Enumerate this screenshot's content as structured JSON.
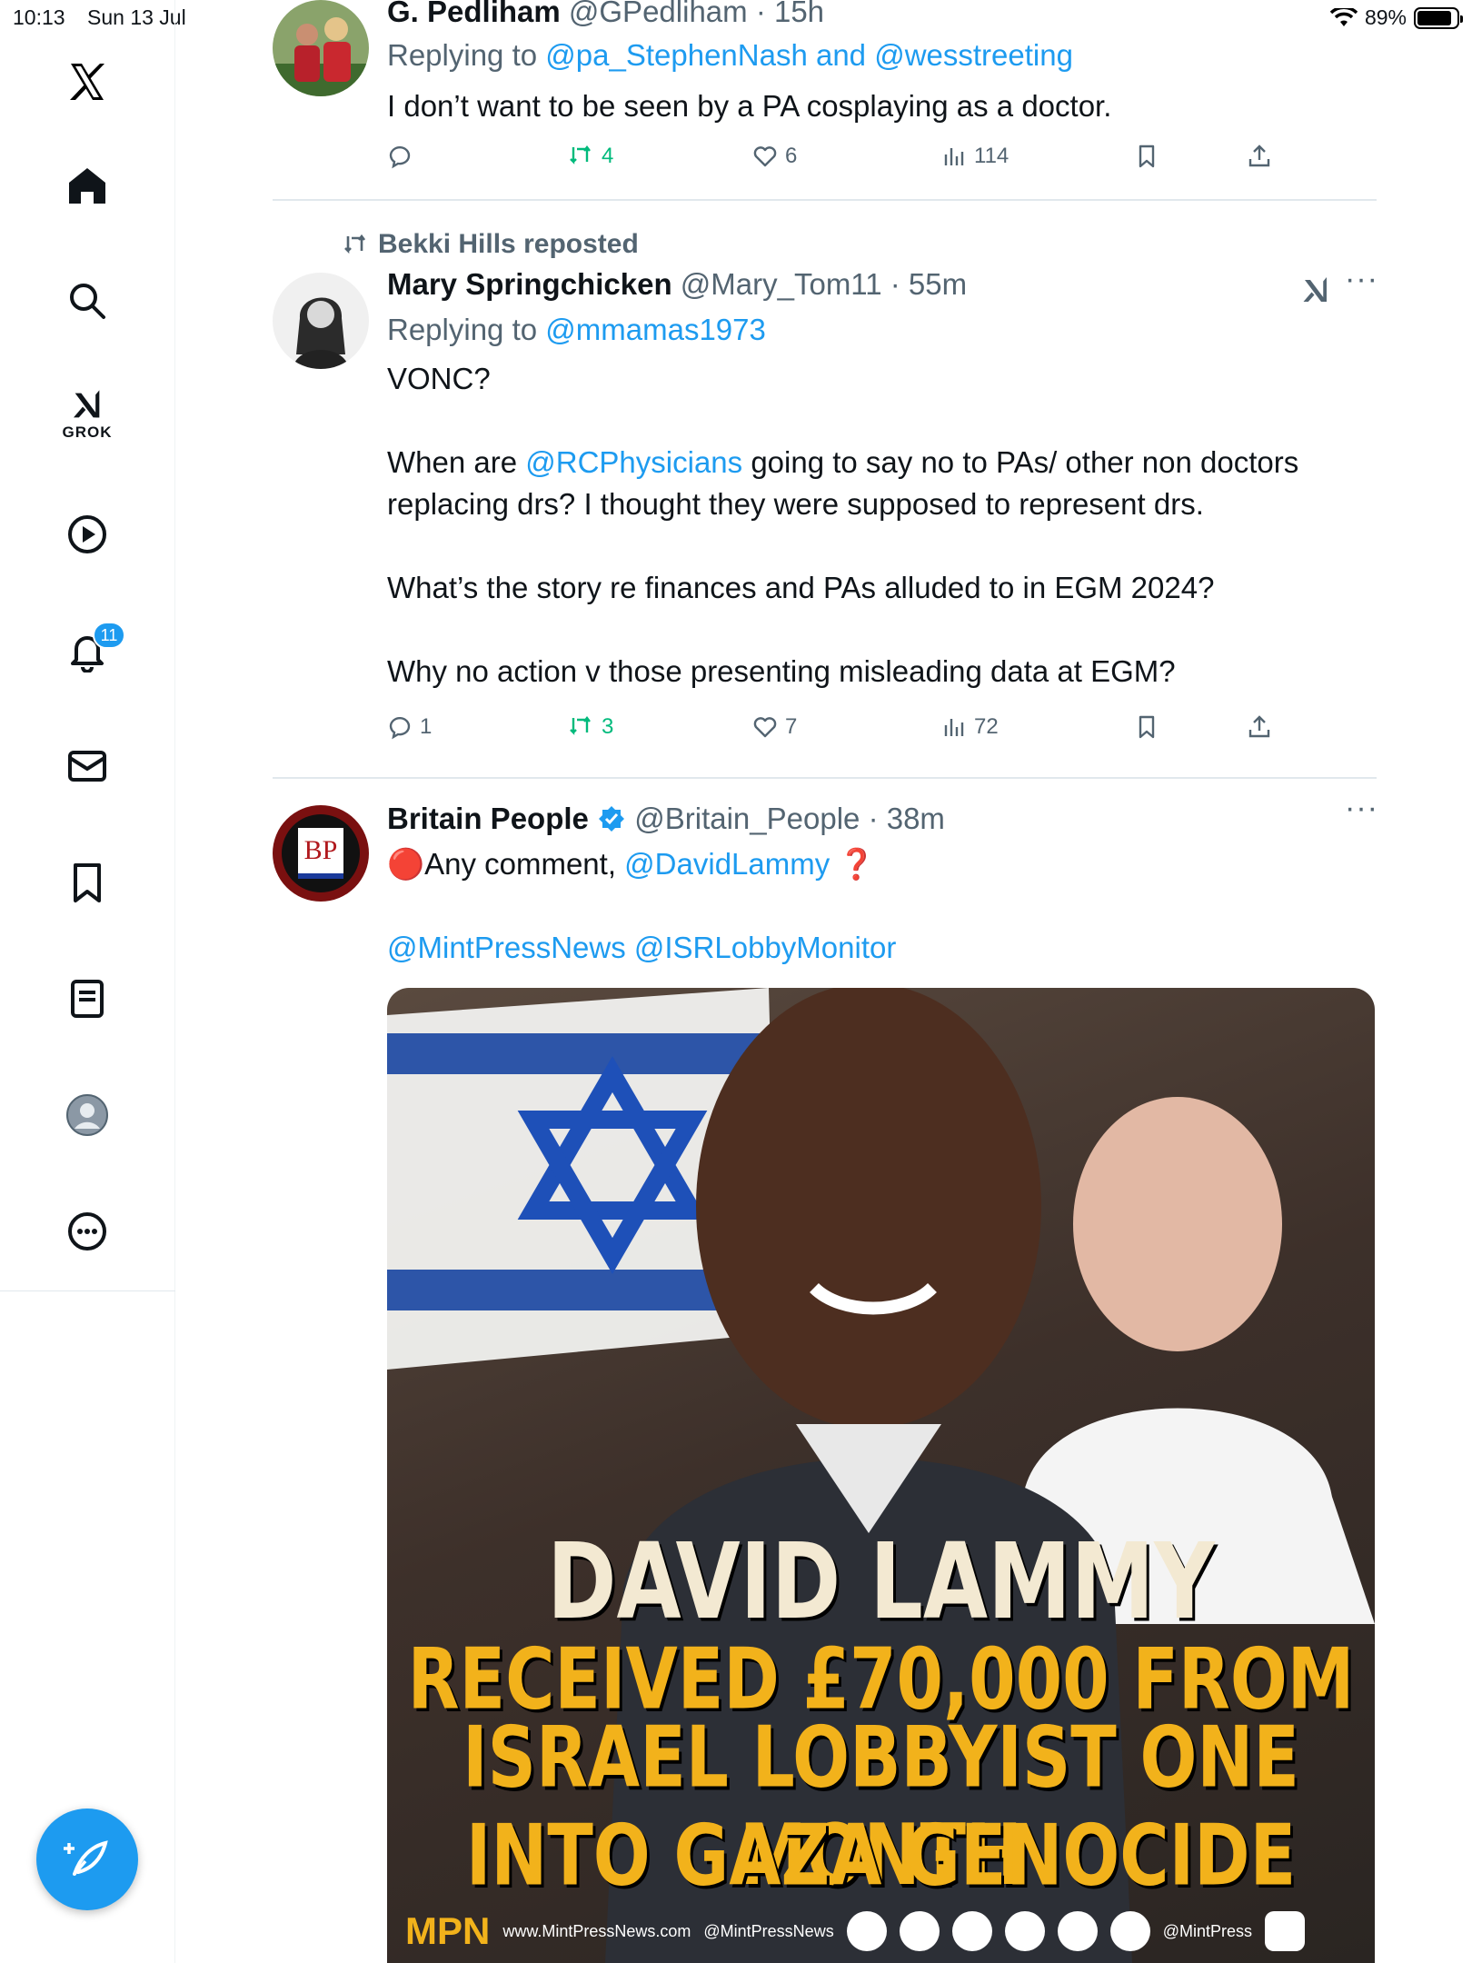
{
  "status_bar": {
    "time": "10:13",
    "date": "Sun 13 Jul",
    "battery": "89%",
    "battery_level": 0.89
  },
  "sidebar": {
    "grok_label": "GROK",
    "notification_count": "11"
  },
  "tweets": [
    {
      "name": "G. Pedliham",
      "handle": "@GPedliham",
      "time": "· 15h",
      "replying_prefix": "Replying to ",
      "replying_to": "@pa_StephenNash and @wesstreeting",
      "text": "I don’t want to be seen by a PA cosplaying as a doctor.",
      "replies": "",
      "reposts": "4",
      "likes": "6",
      "views": "114"
    },
    {
      "reposted_by": "Bekki Hills reposted",
      "name": "Mary Springchicken",
      "handle": "@Mary_Tom11",
      "time": "· 55m",
      "replying_prefix": "Replying to ",
      "replying_to": "@mmamas1973",
      "line1": "VONC?",
      "line2_pre": "When are ",
      "line2_mention": "@RCPhysicians",
      "line2_post": " going to say no to PAs/ other non doctors replacing drs?  I thought they were supposed to represent drs.",
      "line3": "What’s the story re finances and PAs alluded to in EGM 2024?",
      "line4": "Why no action v those presenting misleading data at EGM?",
      "replies": "1",
      "reposts": "3",
      "likes": "7",
      "views": "72"
    },
    {
      "name": "Britain People",
      "handle": "@Britain_People",
      "time": "· 38m",
      "avatar_text": "BP",
      "line1_pre": "🔴Any comment, ",
      "line1_mention": "@DavidLammy",
      "line1_post": " ❓",
      "mentions": "@MintPressNews @ISRLobbyMonitor",
      "image": {
        "headline1": "DAVID LAMMY",
        "headline2": "RECEIVED £70,000 FROM",
        "headline3": "ISRAEL LOBBYIST ONE MONTH",
        "headline4": "INTO GAZA GENOCIDE",
        "logo": "MPN",
        "site": "www.MintPressNews.com",
        "handle": "@MintPressNews",
        "handle2": "@MintPress"
      }
    }
  ],
  "colors": {
    "accent": "#1d9bf0",
    "repost_green": "#00ba7c",
    "headline_cream": "#f3e9d2",
    "headline_yellow": "#f2b21b"
  }
}
